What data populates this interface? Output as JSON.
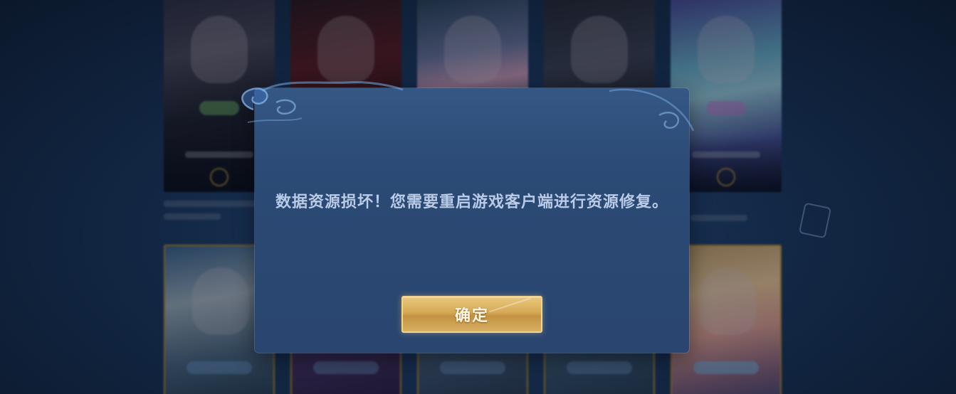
{
  "dialog": {
    "message": "数据资源损坏！您需要重启游戏客户端进行资源修复。",
    "confirm_label": "确定"
  },
  "colors": {
    "dialog_background": "#2b4a74",
    "message_text": "#b9cbe6",
    "confirm_button": "#d6a954"
  }
}
